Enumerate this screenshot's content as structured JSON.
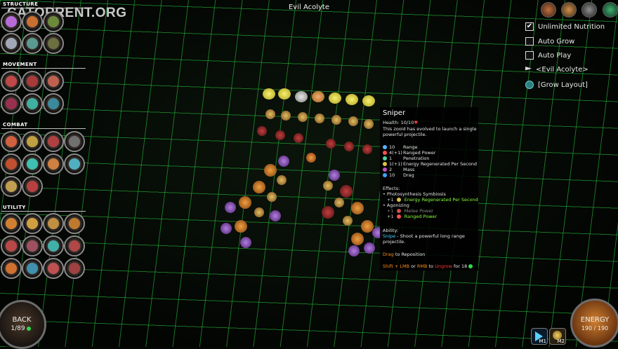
{
  "window_title": "Evil Acolyte",
  "watermark": "CATORRENT.ORG",
  "sidebar": {
    "categories": [
      {
        "label": "STRUCTURE"
      },
      {
        "label": "MOVEMENT"
      },
      {
        "label": "COMBAT"
      },
      {
        "label": "UTILITY"
      }
    ]
  },
  "options": {
    "unlimited_nutrition": {
      "label": "Unlimited Nutrition",
      "checked": true
    },
    "auto_grow": {
      "label": "Auto Grow",
      "checked": false
    },
    "auto_play": {
      "label": "Auto Play",
      "checked": false
    },
    "creature_name": "<Evil Acolyte>",
    "grow_layout": "[Grow Layout]"
  },
  "tooltip": {
    "title": "Sniper",
    "health": "Health: 10/10",
    "description_1": "This zooid has evolved to launch a single",
    "description_2": "powerful projectile.",
    "stats": [
      {
        "value": "10",
        "label": "Range",
        "color": "#5ab0ff"
      },
      {
        "value": "4(+1)",
        "label": "Ranged Power",
        "color": "#ff5050"
      },
      {
        "value": "1",
        "label": "Penetration",
        "color": "#50d0a0"
      },
      {
        "value": "1(+1)",
        "label": "Energy Regenerated Per Second",
        "color": "#e0c040"
      },
      {
        "value": "2",
        "label": "Mass",
        "color": "#c050c0"
      },
      {
        "value": "10",
        "label": "Drag",
        "color": "#40a0ff"
      }
    ],
    "effects_header": "Effects:",
    "effect_1": "• Photosynthesis Symbiosis",
    "effect_1_detail_value": "+1",
    "effect_1_detail_label": "Energy Regenerated Per Second",
    "effect_2": "• Agonizing",
    "effect_2_detail_a_value": "+1",
    "effect_2_detail_a_label": "Melee Power",
    "effect_2_detail_b_value": "+1",
    "effect_2_detail_b_label": "Ranged Power",
    "ability_header": "Ability:",
    "ability_name": "Snipe",
    "ability_text_1": " - Shoot a powerful long range",
    "ability_text_2": "projectile.",
    "drag_key": "Drag",
    "drag_text": " to Reposition",
    "ungrow_shift_lmb": "Shift + LMB",
    "ungrow_or": " or ",
    "ungrow_rmb": "RMB",
    "ungrow_to": " to ",
    "ungrow_word": "Ungrow",
    "ungrow_for": " for 18"
  },
  "back_button": {
    "label": "BACK",
    "count": "1/89"
  },
  "energy": {
    "label": "ENERGY",
    "value": "190 / 190"
  },
  "hotkeys": {
    "m1": "M1",
    "m2": "M2"
  },
  "colors": {
    "accent_green": "#2fd84a",
    "highlight_orange": "#ff8c1a",
    "ranged_green": "#8cff3a",
    "ability_cyan": "#4fd8ff"
  },
  "icons": {
    "creature": [
      "nose-creature-icon",
      "spiral-creature-icon",
      "gear-creature-icon",
      "leaf-creature-icon"
    ]
  }
}
